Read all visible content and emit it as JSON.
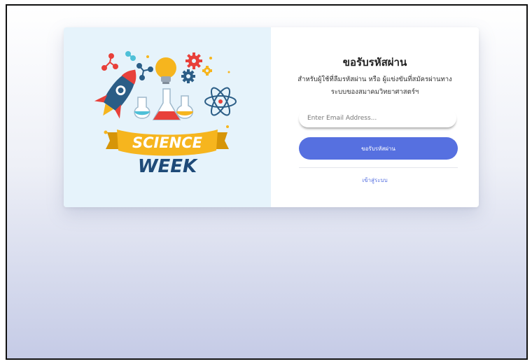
{
  "illustration": {
    "title_line1": "SCIENCE",
    "title_line2": "WEEK",
    "colors": {
      "ribbon": "#f6b51e",
      "word_week": "#1e4a78",
      "rocket": "#2b5d86",
      "flask": "#e8403a",
      "panel_bg": "#e6f3fb"
    }
  },
  "form": {
    "title": "ขอรับรหัสผ่าน",
    "subtitle": "สำหรับผู้ใช้ที่ลืมรหัสผ่าน หรือ ผู้แข่งขันที่สมัครผ่านทาง ระบบของสมาคมวิทยาศาสตร์ฯ",
    "email_placeholder": "Enter Email Address...",
    "email_value": "",
    "submit_label": "ขอรับรหัสผ่าน",
    "login_link": "เข้าสู่ระบบ"
  },
  "colors": {
    "accent": "#5670e0"
  }
}
